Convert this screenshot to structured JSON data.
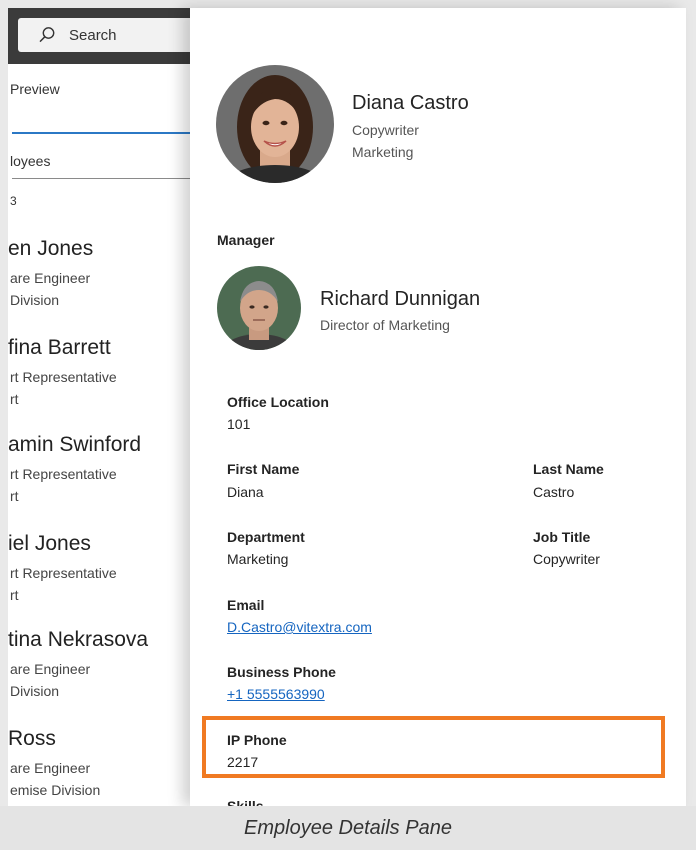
{
  "background_app": {
    "search": {
      "label": "Search",
      "icon": "search-icon"
    },
    "preview_tab": "Preview",
    "employees_field": "loyees",
    "count": "3",
    "employees": [
      {
        "name": "en Jones",
        "role": "are Engineer",
        "dept": "Division"
      },
      {
        "name": "fina Barrett",
        "role": "rt Representative",
        "dept": "rt"
      },
      {
        "name": "amin Swinford",
        "role": "rt Representative",
        "dept": "rt"
      },
      {
        "name": "iel Jones",
        "role": "rt Representative",
        "dept": "rt"
      },
      {
        "name": "tina Nekrasova",
        "role": "are Engineer",
        "dept": "Division"
      },
      {
        "name": "Ross",
        "role": "are Engineer",
        "dept": "emise Division"
      }
    ]
  },
  "employee": {
    "name": "Diana Castro",
    "title": "Copywriter",
    "department": "Marketing"
  },
  "manager": {
    "heading": "Manager",
    "name": "Richard Dunnigan",
    "title": "Director of Marketing"
  },
  "fields": {
    "office_location": {
      "label": "Office Location",
      "value": "101"
    },
    "first_name": {
      "label": "First Name",
      "value": "Diana"
    },
    "last_name": {
      "label": "Last Name",
      "value": "Castro"
    },
    "department": {
      "label": "Department",
      "value": "Marketing"
    },
    "job_title": {
      "label": "Job Title",
      "value": "Copywriter"
    },
    "email": {
      "label": "Email",
      "value": "D.Castro@vitextra.com"
    },
    "business_phone": {
      "label": "Business Phone",
      "value": "+1 5555563990"
    },
    "ip_phone": {
      "label": "IP Phone",
      "value": "2217"
    },
    "skills": {
      "label": "Skills"
    }
  },
  "colors": {
    "highlight": "#f07a22",
    "link": "#1565c0",
    "accent": "#2b78c5"
  },
  "caption": "Employee Details Pane"
}
